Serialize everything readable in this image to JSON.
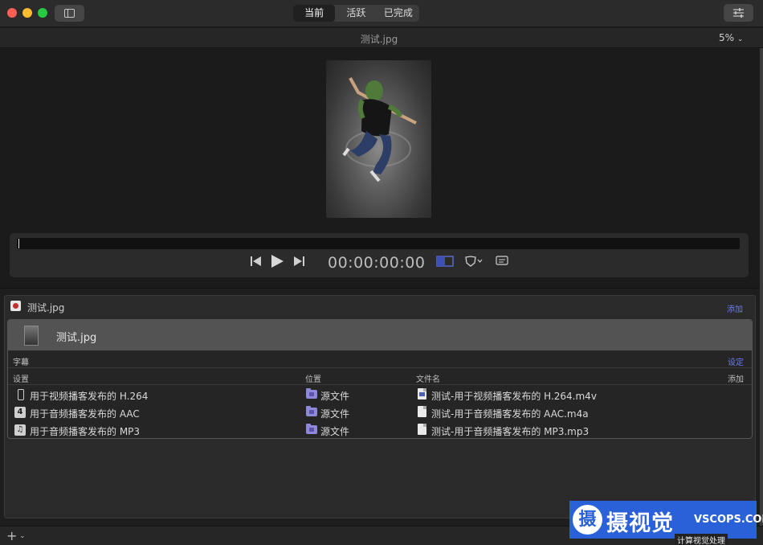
{
  "titlebar": {
    "tabs": [
      {
        "label": "当前",
        "active": true
      },
      {
        "label": "活跃",
        "active": false
      },
      {
        "label": "已完成",
        "active": false
      }
    ]
  },
  "viewer": {
    "title": "测试.jpg",
    "zoom": "5%",
    "timecode": "00:00:00:00"
  },
  "batch": {
    "title": "测试.jpg",
    "add_label": "添加",
    "file": {
      "name": "测试.jpg",
      "caption_label": "字幕",
      "caption_action": "设定",
      "columns": [
        "设置",
        "位置",
        "文件名"
      ],
      "add_label": "添加",
      "outputs": [
        {
          "setting": "用于视频播客发布的 H.264",
          "setting_icon": "phone-icon",
          "location": "源文件",
          "filename": "测试-用于视频播客发布的 H.264.m4v",
          "file_icon": "video-file-icon"
        },
        {
          "setting": "用于音频播客发布的 AAC",
          "setting_icon": "aac-icon",
          "location": "源文件",
          "filename": "测试-用于音频播客发布的 AAC.m4a",
          "file_icon": "audio-file-icon"
        },
        {
          "setting": "用于音频播客发布的 MP3",
          "setting_icon": "music-note-icon",
          "location": "源文件",
          "filename": "测试-用于音频播客发布的 MP3.mp3",
          "file_icon": "audio-file-icon"
        }
      ]
    }
  },
  "watermark": {
    "seal": "摄",
    "cn": "摄视觉",
    "en": "VSCOPS.COM",
    "sub": "计算视觉处理"
  },
  "colors": {
    "accent_link": "#6c7cf0",
    "folder": "#8f87d8",
    "watermark_bg": "#2a61d8"
  }
}
